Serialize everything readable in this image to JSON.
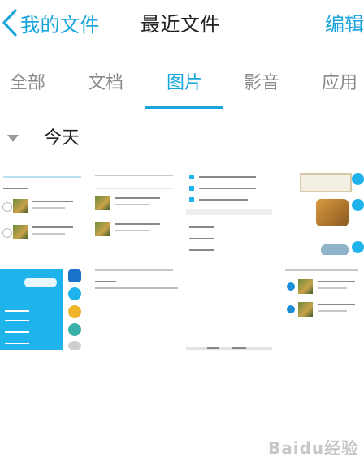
{
  "nav": {
    "back_label": "我的文件",
    "title": "最近文件",
    "edit_label": "编辑"
  },
  "tabs": [
    {
      "label": "全部",
      "active": false
    },
    {
      "label": "文档",
      "active": false
    },
    {
      "label": "图片",
      "active": true
    },
    {
      "label": "影音",
      "active": false
    },
    {
      "label": "应用",
      "active": false
    }
  ],
  "section": {
    "label": "今天",
    "caret_icon": "triangle-down-icon"
  },
  "thumbnails": [
    {
      "name": "screenshot-1"
    },
    {
      "name": "screenshot-2"
    },
    {
      "name": "screenshot-3"
    },
    {
      "name": "screenshot-4"
    },
    {
      "name": "screenshot-5"
    },
    {
      "name": "screenshot-6"
    },
    {
      "name": "screenshot-7"
    },
    {
      "name": "screenshot-8"
    }
  ],
  "watermark": {
    "text": "Baidu经验"
  },
  "colors": {
    "accent": "#1aa6dc",
    "tab_inactive": "#8a8a8a",
    "divider": "#d9d9d9"
  }
}
